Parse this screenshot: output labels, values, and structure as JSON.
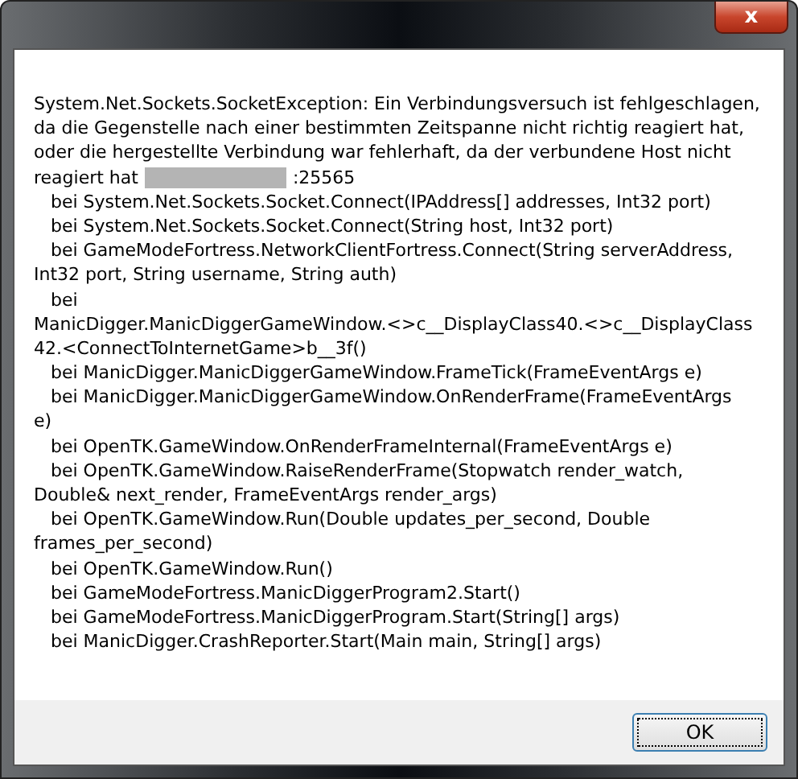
{
  "window": {
    "close_label": "x"
  },
  "message_lines": [
    {
      "kind": "text",
      "text": "System.Net.Sockets.SocketException: Ein Verbindungsversuch ist fehlgeschlagen,"
    },
    {
      "kind": "text",
      "text": "da die Gegenstelle nach einer bestimmten Zeitspanne nicht richtig reagiert hat,"
    },
    {
      "kind": "text",
      "text": "oder die hergestellte Verbindung war fehlerhaft, da der verbundene Host nicht"
    },
    {
      "kind": "redacted",
      "before": "reagiert hat",
      "after": ":25565"
    },
    {
      "kind": "text",
      "text": "   bei System.Net.Sockets.Socket.Connect(IPAddress[] addresses, Int32 port)"
    },
    {
      "kind": "text",
      "text": "   bei System.Net.Sockets.Socket.Connect(String host, Int32 port)"
    },
    {
      "kind": "text",
      "text": "   bei GameModeFortress.NetworkClientFortress.Connect(String serverAddress,"
    },
    {
      "kind": "text",
      "text": "Int32 port, String username, String auth)"
    },
    {
      "kind": "text",
      "text": "   bei"
    },
    {
      "kind": "text",
      "text": "ManicDigger.ManicDiggerGameWindow.<>c__DisplayClass40.<>c__DisplayClass"
    },
    {
      "kind": "text",
      "text": "42.<ConnectToInternetGame>b__3f()"
    },
    {
      "kind": "text",
      "text": "   bei ManicDigger.ManicDiggerGameWindow.FrameTick(FrameEventArgs e)"
    },
    {
      "kind": "text",
      "text": "   bei ManicDigger.ManicDiggerGameWindow.OnRenderFrame(FrameEventArgs"
    },
    {
      "kind": "text",
      "text": "e)"
    },
    {
      "kind": "text",
      "text": "   bei OpenTK.GameWindow.OnRenderFrameInternal(FrameEventArgs e)"
    },
    {
      "kind": "text",
      "text": "   bei OpenTK.GameWindow.RaiseRenderFrame(Stopwatch render_watch,"
    },
    {
      "kind": "text",
      "text": "Double& next_render, FrameEventArgs render_args)"
    },
    {
      "kind": "text",
      "text": "   bei OpenTK.GameWindow.Run(Double updates_per_second, Double"
    },
    {
      "kind": "text",
      "text": "frames_per_second)"
    },
    {
      "kind": "text",
      "text": "   bei OpenTK.GameWindow.Run()"
    },
    {
      "kind": "text",
      "text": "   bei GameModeFortress.ManicDiggerProgram2.Start()"
    },
    {
      "kind": "text",
      "text": "   bei GameModeFortress.ManicDiggerProgram.Start(String[] args)"
    },
    {
      "kind": "text",
      "text": "   bei ManicDigger.CrashReporter.Start(Main main, String[] args)"
    }
  ],
  "buttons": [
    {
      "label": "OK",
      "focused": true
    }
  ]
}
